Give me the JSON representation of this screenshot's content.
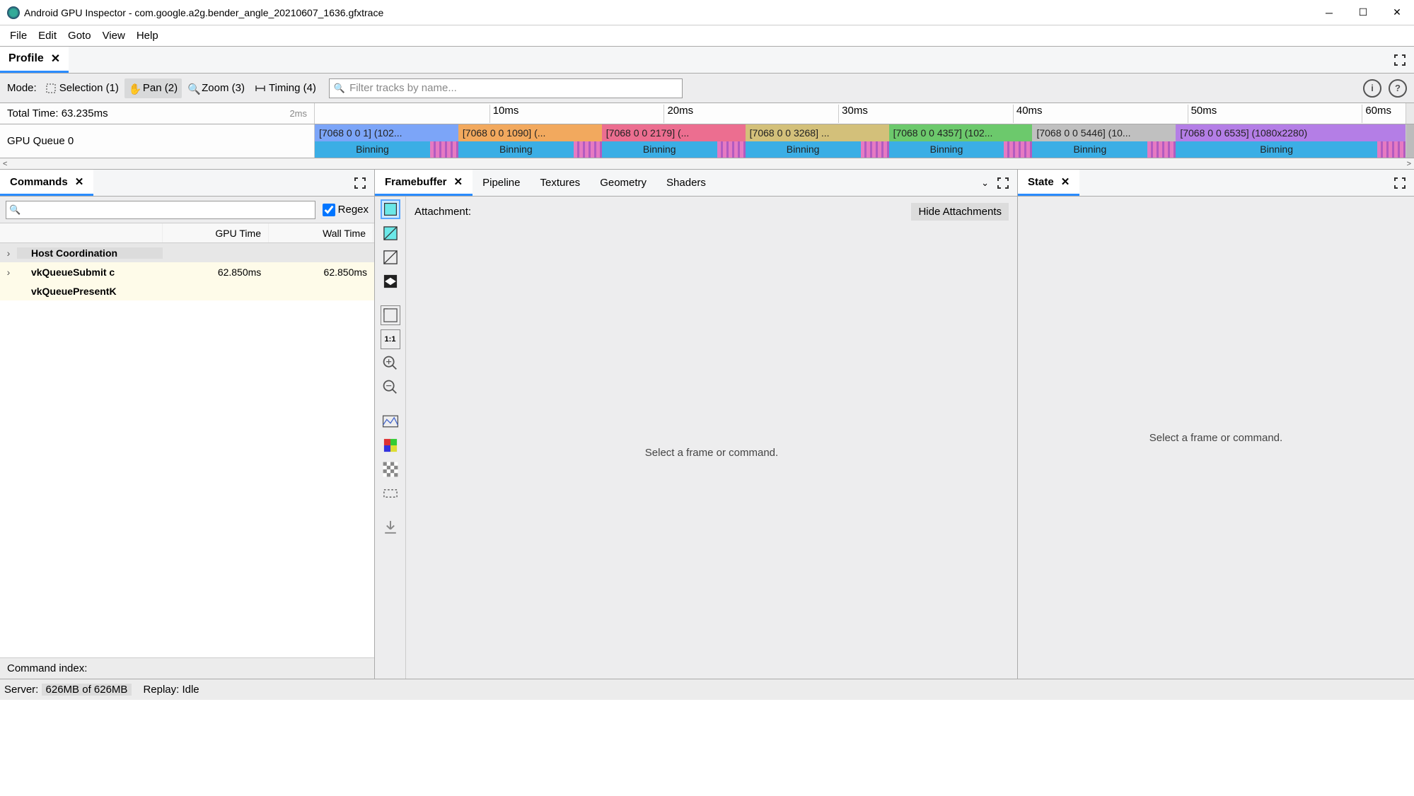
{
  "window": {
    "title": "Android GPU Inspector - com.google.a2g.bender_angle_20210607_1636.gfxtrace"
  },
  "menu": [
    "File",
    "Edit",
    "Goto",
    "View",
    "Help"
  ],
  "profile_tab": "Profile",
  "mode": {
    "label": "Mode:",
    "selection": "Selection (1)",
    "pan": "Pan (2)",
    "zoom": "Zoom (3)",
    "timing": "Timing (4)"
  },
  "filter_placeholder": "Filter tracks by name...",
  "timeline": {
    "total_label": "Total Time: 63.235ms",
    "scale_hint": "2ms",
    "ticks": [
      "10ms",
      "20ms",
      "30ms",
      "40ms",
      "50ms",
      "60ms"
    ]
  },
  "queue": {
    "label": "GPU Queue 0",
    "blocks": [
      {
        "hdr": "[7068 0 0 1] (102...",
        "bin": "Binning",
        "color": "#7ca5f8"
      },
      {
        "hdr": "[7068 0 0 1090] (...",
        "bin": "Binning",
        "color": "#f2a95e"
      },
      {
        "hdr": "[7068 0 0 2179] (...",
        "bin": "Binning",
        "color": "#ec6e90"
      },
      {
        "hdr": "[7068 0 0 3268] ...",
        "bin": "Binning",
        "color": "#d3c07a"
      },
      {
        "hdr": "[7068 0 0 4357] (102...",
        "bin": "Binning",
        "color": "#6cc96c"
      },
      {
        "hdr": "[7068 0 0 5446] (10...",
        "bin": "Binning",
        "color": "#c0c0c0"
      },
      {
        "hdr": "[7068 0 0 6535] (1080x2280)",
        "bin": "Binning",
        "color": "#b47ee6"
      }
    ]
  },
  "commands": {
    "tab": "Commands",
    "regex": "Regex",
    "cols": {
      "gpu": "GPU Time",
      "wall": "Wall Time"
    },
    "rows": [
      {
        "name": "Host Coordination",
        "gpu": "",
        "wall": ""
      },
      {
        "name": "vkQueueSubmit c",
        "gpu": "62.850ms",
        "wall": "62.850ms"
      },
      {
        "name": "vkQueuePresentK",
        "gpu": "",
        "wall": ""
      }
    ],
    "footer": "Command index:"
  },
  "center": {
    "tabs": [
      "Framebuffer",
      "Pipeline",
      "Textures",
      "Geometry",
      "Shaders"
    ],
    "attachment": "Attachment:",
    "hide": "Hide Attachments",
    "placeholder": "Select a frame or command."
  },
  "state": {
    "tab": "State",
    "placeholder": "Select a frame or command."
  },
  "status": {
    "server_label": "Server:",
    "server_val": "626MB of 626MB",
    "replay_label": "Replay:",
    "replay_val": "Idle"
  }
}
